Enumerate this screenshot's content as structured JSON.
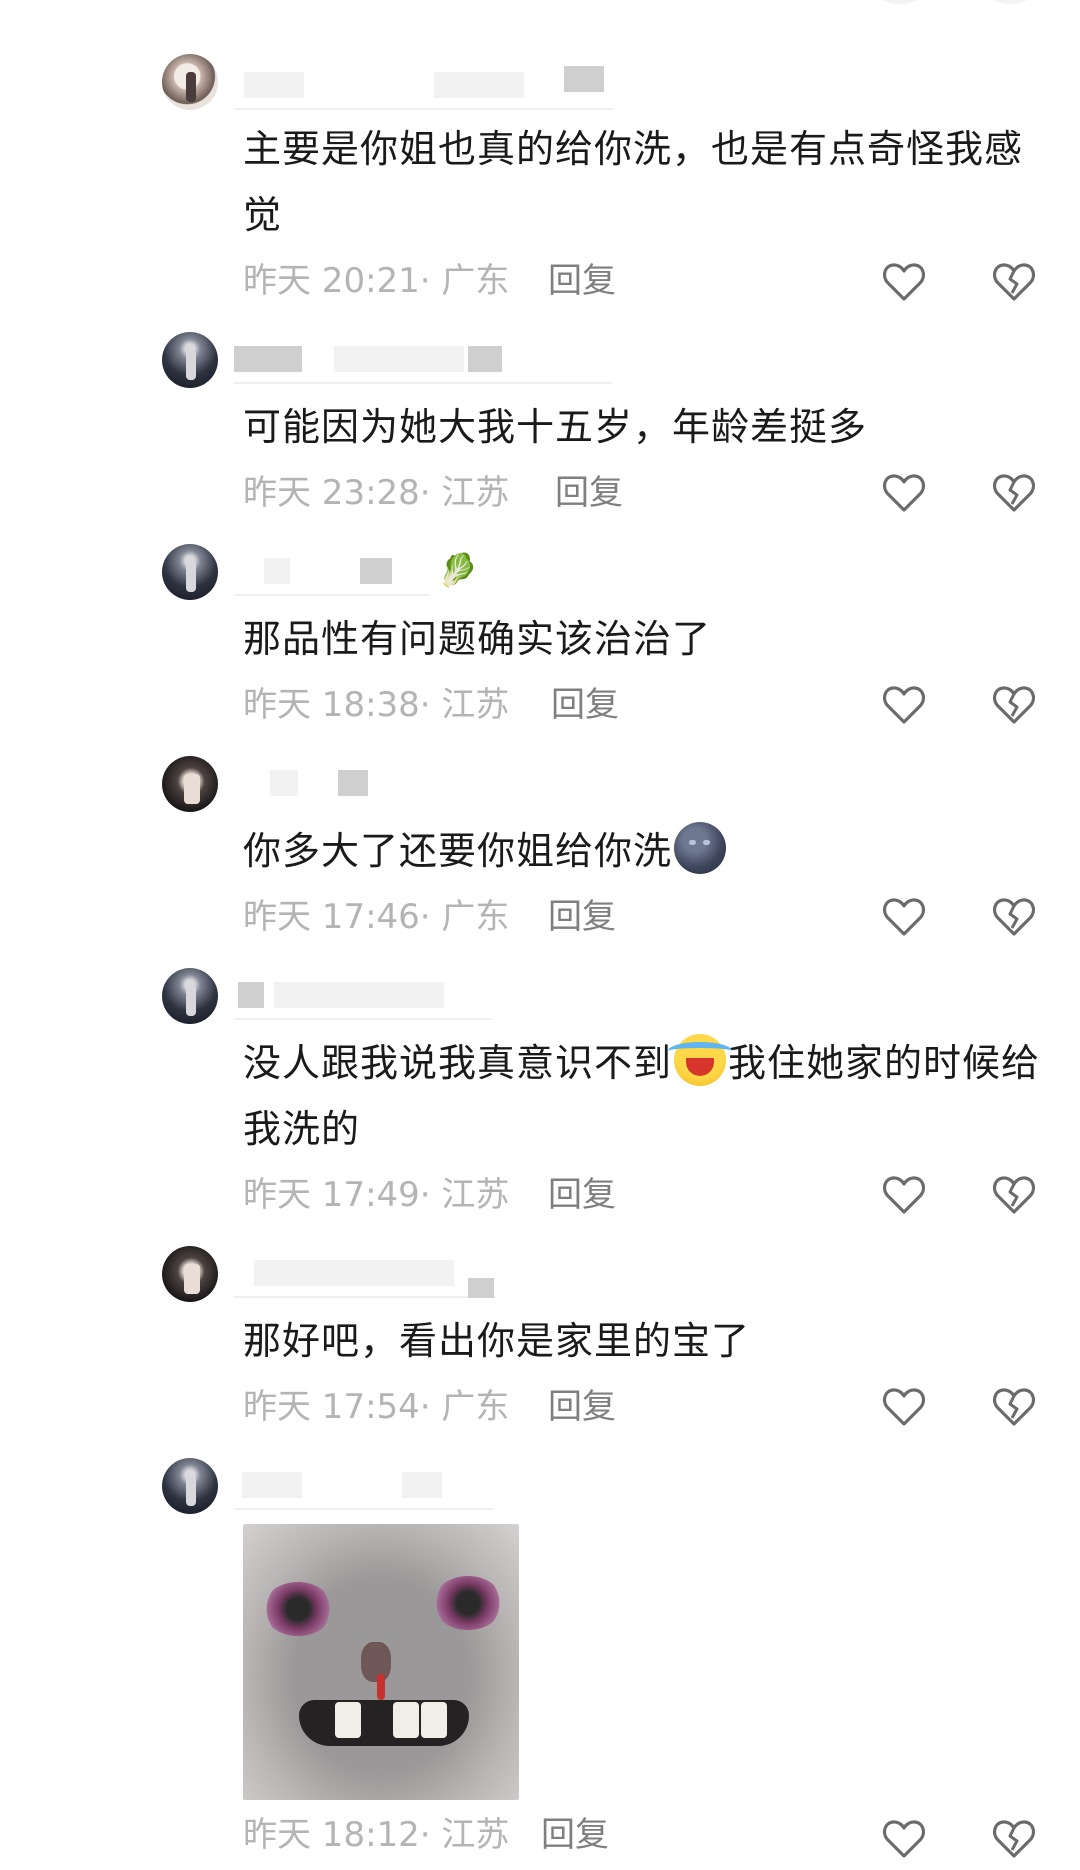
{
  "comments": [
    {
      "text": "主要是你姐也真的给你洗，也是有点奇怪我感觉",
      "time": "昨天 20:21",
      "region": "广东",
      "reply": "回复"
    },
    {
      "text": "可能因为她大我十五岁，年龄差挺多",
      "time": "昨天 23:28",
      "region": "江苏",
      "reply": "回复"
    },
    {
      "text": "那品性有问题确实该治治了",
      "time": "昨天 18:38",
      "region": "江苏",
      "reply": "回复",
      "name_emoji": "🥬"
    },
    {
      "text_before": "你多大了还要你姐给你洗",
      "emoji_after": "new-moon-face-emoji",
      "time": "昨天 17:46",
      "region": "广东",
      "reply": "回复"
    },
    {
      "text_before": "没人跟我说我真意识不到",
      "emoji_mid": "crying-laughing-emoji",
      "text_after": "我住她家的时候给我洗的",
      "time": "昨天 17:49",
      "region": "江苏",
      "reply": "回复"
    },
    {
      "text": "那好吧，看出你是家里的宝了",
      "time": "昨天 17:54",
      "region": "广东",
      "reply": "回复"
    },
    {
      "sticker": "battered-hamster-meme",
      "time": "昨天 18:12",
      "region": "江苏",
      "reply": "回复"
    }
  ],
  "icons": {
    "like": "heart-outline-icon",
    "dislike": "broken-heart-icon"
  },
  "colors": {
    "text": "#1a1a1a",
    "meta": "#b4b4b4",
    "reply": "#7f7f7f",
    "icon": "#6b6b6b"
  }
}
